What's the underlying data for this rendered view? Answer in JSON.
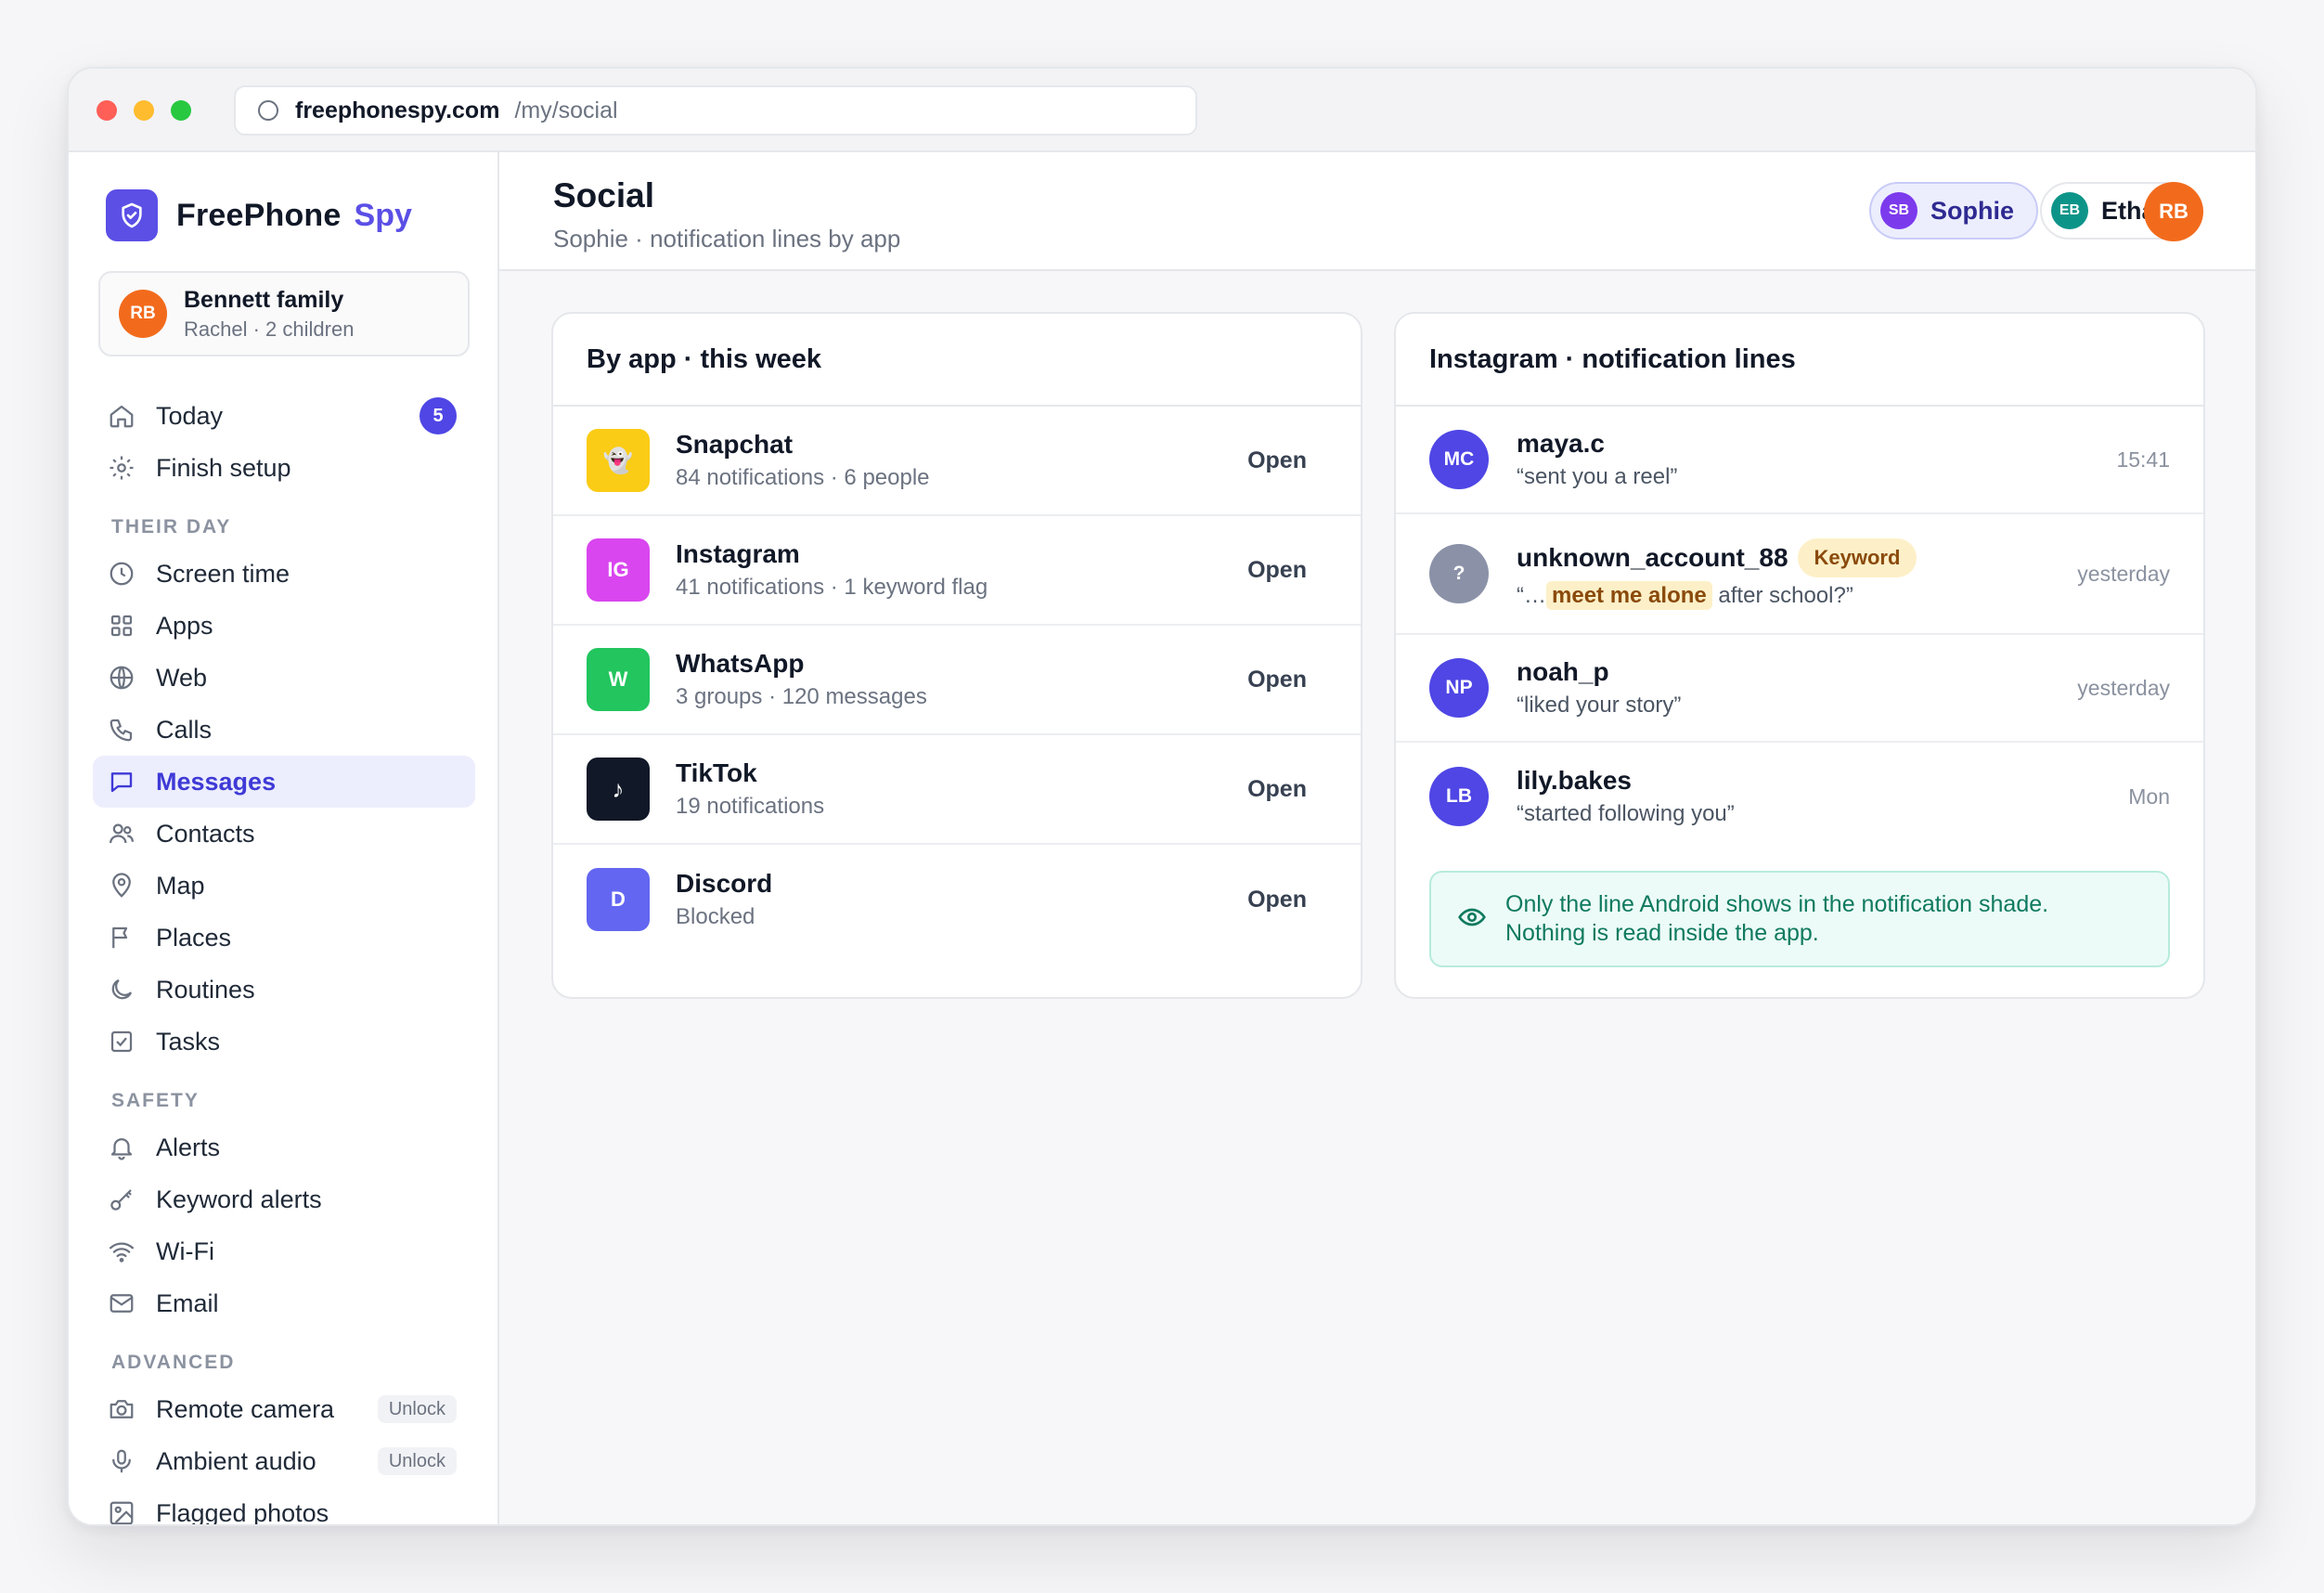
{
  "browser": {
    "domain": "freephonespy.com",
    "path": "/my/social"
  },
  "brand": {
    "name": "FreePhone",
    "accent": "Spy",
    "accent_color": "#5b4fe6"
  },
  "family": {
    "initials": "RB",
    "name": "Bennett family",
    "sub": "Rachel · 2 children"
  },
  "sidebar": {
    "top_items": [
      {
        "label": "Today",
        "icon": "home-icon",
        "badge": "5"
      },
      {
        "label": "Finish setup",
        "icon": "gear-icon"
      }
    ],
    "section_their_day": "THEIR DAY",
    "their_day": [
      {
        "label": "Screen time",
        "icon": "clock-icon"
      },
      {
        "label": "Apps",
        "icon": "grid-icon"
      },
      {
        "label": "Web",
        "icon": "globe-icon"
      },
      {
        "label": "Calls",
        "icon": "phone-icon"
      },
      {
        "label": "Messages",
        "icon": "message-icon",
        "active": true
      },
      {
        "label": "Contacts",
        "icon": "users-icon"
      },
      {
        "label": "Map",
        "icon": "map-pin-icon"
      },
      {
        "label": "Places",
        "icon": "flag-icon"
      },
      {
        "label": "Routines",
        "icon": "moon-icon"
      },
      {
        "label": "Tasks",
        "icon": "checkbox-icon"
      }
    ],
    "section_safety": "SAFETY",
    "safety": [
      {
        "label": "Alerts",
        "icon": "bell-icon"
      },
      {
        "label": "Keyword alerts",
        "icon": "key-icon"
      },
      {
        "label": "Wi-Fi",
        "icon": "wifi-icon"
      },
      {
        "label": "Email",
        "icon": "mail-icon"
      }
    ],
    "section_advanced": "ADVANCED",
    "advanced": [
      {
        "label": "Remote camera",
        "icon": "camera-icon",
        "tag": "Unlock"
      },
      {
        "label": "Ambient audio",
        "icon": "mic-icon",
        "tag": "Unlock"
      },
      {
        "label": "Flagged photos",
        "icon": "image-icon"
      }
    ]
  },
  "header": {
    "title": "Social",
    "subtitle": "Sophie · notification lines by app",
    "children": [
      {
        "initials": "SB",
        "name": "Sophie",
        "color": "#7c3aed",
        "active": true
      },
      {
        "initials": "EB",
        "name": "Ethan",
        "color": "#0d9488",
        "active": false
      }
    ],
    "user_initials": "RB"
  },
  "by_app": {
    "title": "By app · this week",
    "open_label": "Open",
    "apps": [
      {
        "icon_text": "👻",
        "name": "Snapchat",
        "sub": "84 notifications · 6 people",
        "color": "#facc15"
      },
      {
        "icon_text": "IG",
        "name": "Instagram",
        "sub": "41 notifications · 1 keyword flag",
        "color": "#d946ef"
      },
      {
        "icon_text": "W",
        "name": "WhatsApp",
        "sub": "3 groups · 120 messages",
        "color": "#22c55e"
      },
      {
        "icon_text": "♪",
        "name": "TikTok",
        "sub": "19 notifications",
        "color": "#111827"
      },
      {
        "icon_text": "D",
        "name": "Discord",
        "sub": "Blocked",
        "color": "#6366f1"
      }
    ]
  },
  "instagram": {
    "title": "Instagram · notification lines",
    "items": [
      {
        "initials": "MC",
        "name": "maya.c",
        "line": "“sent you a reel”",
        "time": "15:41",
        "color": "#4f46e5"
      },
      {
        "initials": "?",
        "name": "unknown_account_88",
        "badge": "Keyword",
        "line_prefix": "“…",
        "line_highlight": "meet me alone",
        "line_suffix": "after school?”",
        "time": "yesterday",
        "color": "#8b92a8"
      },
      {
        "initials": "NP",
        "name": "noah_p",
        "line": "“liked your story”",
        "time": "yesterday",
        "color": "#4f46e5"
      },
      {
        "initials": "LB",
        "name": "lily.bakes",
        "line": "“started following you”",
        "time": "Mon",
        "color": "#4f46e5"
      }
    ],
    "note_line1": "Only the line Android shows in the notification shade.",
    "note_line2": "Nothing is read inside the app."
  }
}
